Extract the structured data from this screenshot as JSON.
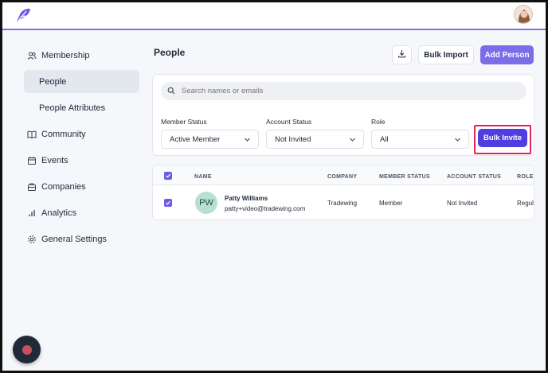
{
  "header": {
    "logo_icon": "feather-logo-icon",
    "avatar_icon": "user-avatar-photo"
  },
  "sidebar": {
    "items": [
      {
        "label": "Membership",
        "icon": "users-icon"
      },
      {
        "label": "People"
      },
      {
        "label": "People Attributes"
      },
      {
        "label": "Community",
        "icon": "book-icon"
      },
      {
        "label": "Events",
        "icon": "calendar-icon"
      },
      {
        "label": "Companies",
        "icon": "building-icon"
      },
      {
        "label": "Analytics",
        "icon": "bar-chart-icon"
      },
      {
        "label": "General Settings",
        "icon": "gear-icon"
      }
    ]
  },
  "main": {
    "title": "People",
    "download_icon": "download-icon",
    "bulk_import_label": "Bulk Import",
    "add_person_label": "Add Person",
    "search": {
      "placeholder": "Search names or emails"
    },
    "filters": {
      "member_status": {
        "label": "Member Status",
        "value": "Active Member"
      },
      "account_status": {
        "label": "Account Status",
        "value": "Not Invited"
      },
      "role": {
        "label": "Role",
        "value": "All"
      }
    },
    "bulk_invite_label": "Bulk Invite"
  },
  "table": {
    "headers": [
      "NAME",
      "COMPANY",
      "MEMBER STATUS",
      "ACCOUNT STATUS",
      "ROLE"
    ],
    "rows": [
      {
        "initials": "PW",
        "name": "Patty Williams",
        "email": "patty+video@tradewing.com",
        "company": "Tradewing",
        "member_status": "Member",
        "account_status": "Not Invited",
        "role": "Regul"
      }
    ]
  },
  "colors": {
    "accent": "#7b6ce8",
    "highlight": "#e0245e",
    "bulk_invite": "#4f3ee0"
  }
}
